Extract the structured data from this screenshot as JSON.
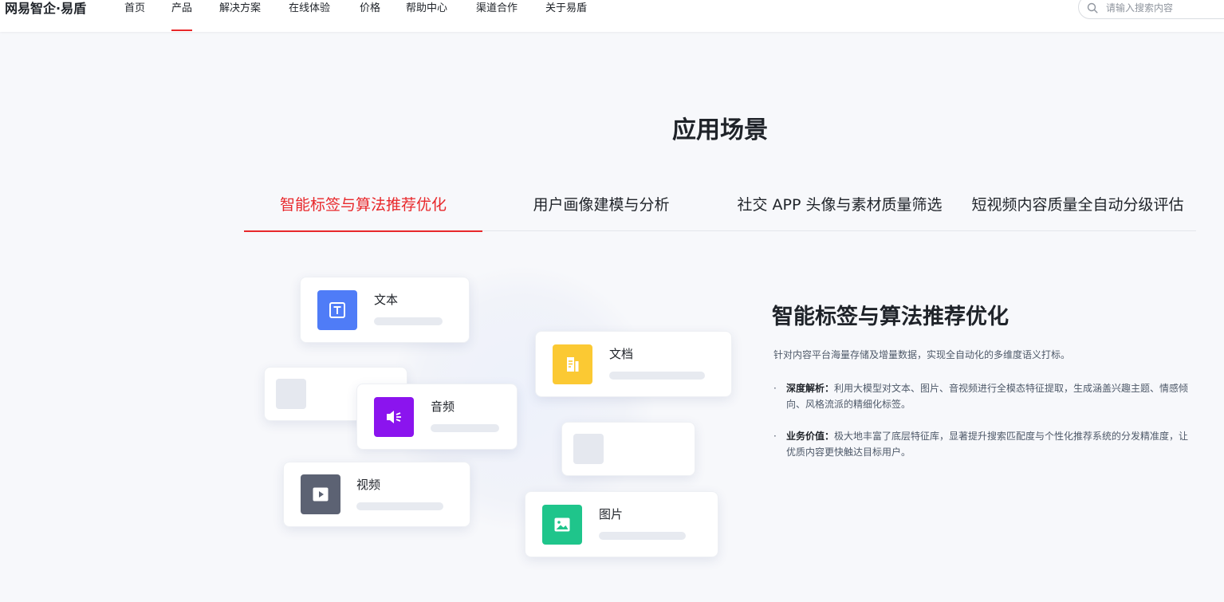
{
  "nav": {
    "logo": "网易智企·易盾",
    "items": [
      "首页",
      "产品",
      "解决方案",
      "在线体验",
      "价格",
      "帮助中心",
      "渠道合作",
      "关于易盾"
    ],
    "active_index": 1,
    "search_placeholder": "请输入搜索内容"
  },
  "section": {
    "title": "应用场景",
    "tabs": [
      "智能标签与算法推荐优化",
      "用户画像建模与分析",
      "社交 APP 头像与素材质量筛选",
      "短视频内容质量全自动分级评估"
    ],
    "active_tab": 0
  },
  "cards": {
    "text": {
      "label": "文本",
      "icon": "text-icon",
      "color": "#4f7cf7"
    },
    "doc": {
      "label": "文档",
      "icon": "document-icon",
      "color": "#fbc933"
    },
    "audio": {
      "label": "音频",
      "icon": "audio-icon",
      "color": "#8b14ee"
    },
    "video": {
      "label": "视频",
      "icon": "video-icon",
      "color": "#5c6273"
    },
    "image": {
      "label": "图片",
      "icon": "image-icon",
      "color": "#1fc58b"
    }
  },
  "detail": {
    "title": "智能标签与算法推荐优化",
    "intro": "针对内容平台海量存储及增量数据，实现全自动化的多维度语义打标。",
    "points": [
      {
        "label": "深度解析：",
        "text": "利用大模型对文本、图片、音视频进行全模态特征提取，生成涵盖兴趣主题、情感倾向、风格流派的精细化标签。"
      },
      {
        "label": "业务价值：",
        "text": "极大地丰富了底层特征库，显著提升搜索匹配度与个性化推荐系统的分发精准度，让优质内容更快触达目标用户。"
      }
    ]
  },
  "colors": {
    "accent": "#e8282b",
    "text": "#1f2329",
    "muted": "#4e5969"
  }
}
